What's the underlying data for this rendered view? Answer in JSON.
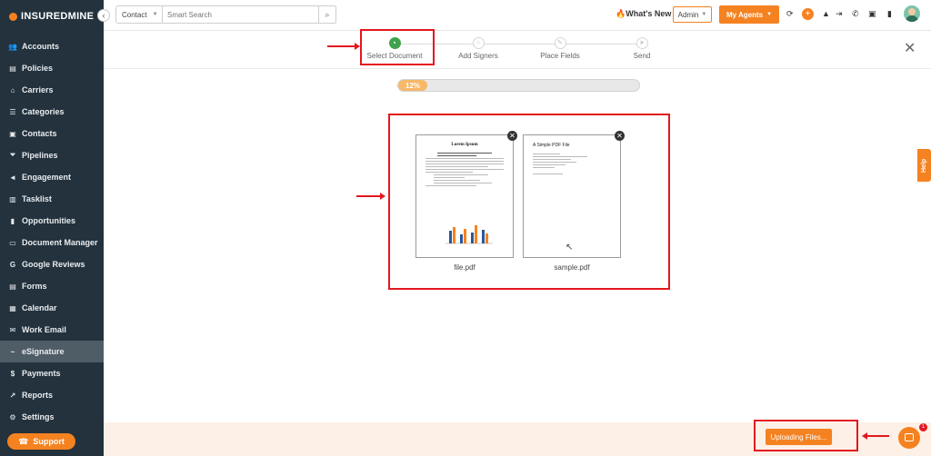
{
  "brand": {
    "name": "INSUREDMINE",
    "accent": "#f58220",
    "sidebar_bg": "#23323d"
  },
  "sidebar": {
    "collapse_icon": "chevron-left-icon",
    "items": [
      {
        "label": "Accounts",
        "icon": "users-icon",
        "glyph": "👥"
      },
      {
        "label": "Policies",
        "icon": "document-icon",
        "glyph": "▤"
      },
      {
        "label": "Carriers",
        "icon": "bank-icon",
        "glyph": "⌂"
      },
      {
        "label": "Categories",
        "icon": "list-icon",
        "glyph": "☰"
      },
      {
        "label": "Contacts",
        "icon": "contact-card-icon",
        "glyph": "▣"
      },
      {
        "label": "Pipelines",
        "icon": "funnel-icon",
        "glyph": "⏷"
      },
      {
        "label": "Engagement",
        "icon": "megaphone-icon",
        "glyph": "◄"
      },
      {
        "label": "Tasklist",
        "icon": "clipboard-icon",
        "glyph": "▥"
      },
      {
        "label": "Opportunities",
        "icon": "bar-chart-icon",
        "glyph": "▮"
      },
      {
        "label": "Document Manager",
        "icon": "folder-icon",
        "glyph": "▭"
      },
      {
        "label": "Google Reviews",
        "icon": "google-icon",
        "glyph": "G"
      },
      {
        "label": "Forms",
        "icon": "form-icon",
        "glyph": "▤"
      },
      {
        "label": "Calendar",
        "icon": "calendar-icon",
        "glyph": "▦"
      },
      {
        "label": "Work Email",
        "icon": "envelope-icon",
        "glyph": "✉"
      },
      {
        "label": "eSignature",
        "icon": "signature-icon",
        "glyph": "~",
        "active": true
      },
      {
        "label": "Payments",
        "icon": "dollar-icon",
        "glyph": "$"
      },
      {
        "label": "Reports",
        "icon": "line-chart-icon",
        "glyph": "↗"
      },
      {
        "label": "Settings",
        "icon": "gear-icon",
        "glyph": "⚙"
      }
    ],
    "support_label": "Support"
  },
  "header": {
    "contact_select": "Contact",
    "search_placeholder": "Smart Search",
    "whats_new": "What's New",
    "admin_select": "Admin",
    "agents_button": "My Agents"
  },
  "stepper": {
    "steps": [
      {
        "label": "Select Document",
        "active": true
      },
      {
        "label": "Add Signers",
        "active": false
      },
      {
        "label": "Place Fields",
        "active": false
      },
      {
        "label": "Send",
        "active": false
      }
    ]
  },
  "upload": {
    "progress_percent": 12,
    "progress_label": "12%",
    "button_label": "Uploading Files..."
  },
  "documents": [
    {
      "file_name": "file.pdf",
      "preview_title": "Lorem Ipsum"
    },
    {
      "file_name": "sample.pdf",
      "preview_title": "A Simple PDF File"
    }
  ],
  "help_tab": "Help",
  "chat": {
    "badge_count": "1"
  }
}
